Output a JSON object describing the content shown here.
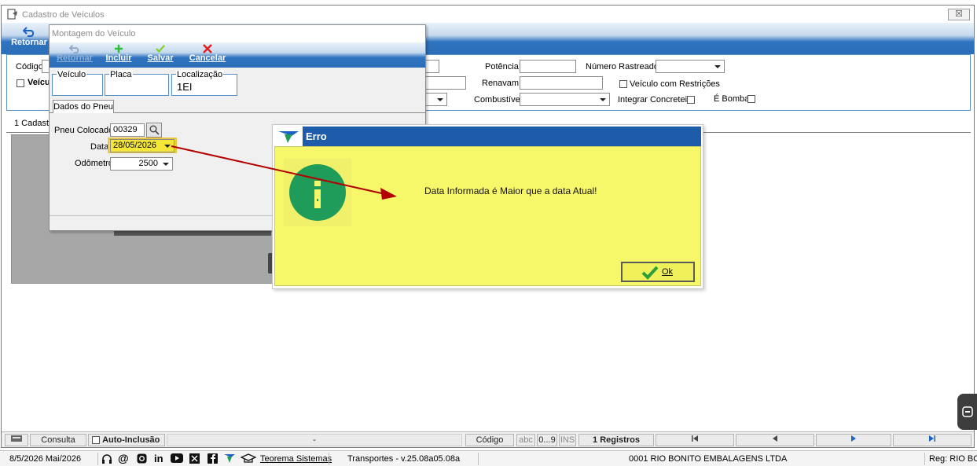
{
  "main_window": {
    "title": "Cadastro de Veículos",
    "close_label": "☒",
    "toolbar": {
      "return_label": "Retornar"
    }
  },
  "main_form": {
    "codigo_label": "Código",
    "veiculo_label": "Veícu",
    "potencia_label": "Potência",
    "numero_rastreador_label": "Número Rastreador",
    "renavam_label": "Renavam",
    "veiculo_restricoes_label": "Veículo com Restrições",
    "combustivel_label": "Combustível",
    "integrar_concreteira_label": "Integrar Concreteira",
    "e_bomba_label": "É Bomba"
  },
  "tabs": {
    "cadastro_label": "1 Cadastro"
  },
  "sub_window": {
    "title": "Montagem do Veículo",
    "toolbar": {
      "return_label": "Retornar",
      "incluir_label": "Incluir",
      "salvar_label": "Salvar",
      "cancelar_label": "Cancelar"
    },
    "groups": {
      "veiculo_label": "Veículo",
      "placa_label": "Placa",
      "localizacao_label": "Localização",
      "localizacao_value": "1EI"
    },
    "tab_label": "Dados do Pneu",
    "fields": {
      "pneu_label": "Pneu Colocado",
      "pneu_value": "00329",
      "data_label": "Data",
      "data_value": "28/05/2026",
      "odometro_label": "Odômetro",
      "odometro_value": "2500"
    }
  },
  "dialog": {
    "title": "Erro",
    "message": "Data Informada é Maior que a data Atual!",
    "ok_label": "Ok"
  },
  "status_bar": {
    "consulta": "Consulta",
    "auto_inclusao": "Auto-Inclusão",
    "dash": "-",
    "codigo": "Código",
    "abc": "abc",
    "nine": "0...9",
    "ins": "INS",
    "registros": "1 Registros"
  },
  "bottom_bar": {
    "date": "8/5/2026 Mai/2026",
    "teorema": "Teorema Sistemas",
    "version": "Transportes - v.25.08a05.08a",
    "company": "0001 RIO BONITO EMBALAGENS LTDA",
    "reg": "Reg: RIO BO"
  },
  "colors": {
    "toolbar_blue": "#2f74c1",
    "dialog_title": "#1c5cab",
    "dialog_body": "#f7f76a",
    "highlight": "#f5e63a",
    "arrow": "#b30000",
    "info_circle": "#1f9b5a"
  }
}
